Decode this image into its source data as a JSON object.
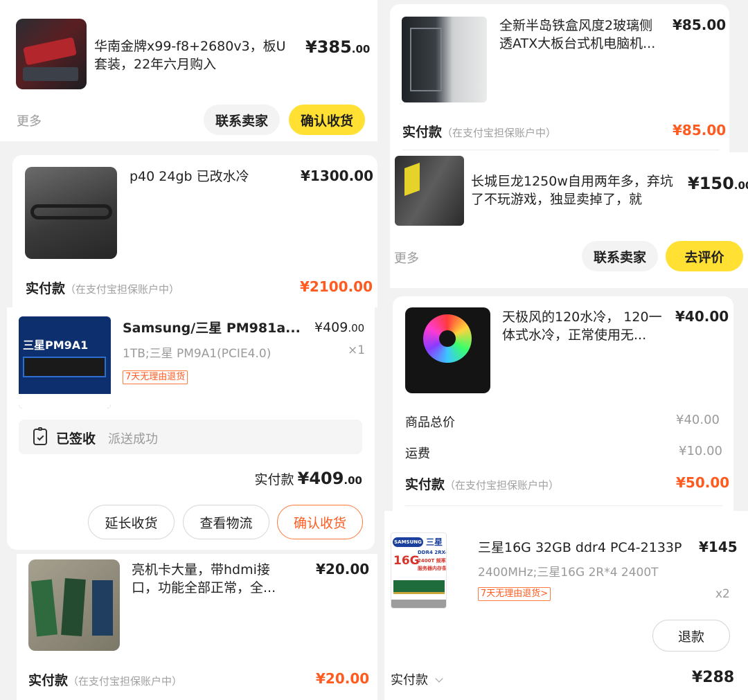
{
  "left": {
    "card1": {
      "title": "华南金牌x99-f8+2680v3，板U套装，22年六月购入",
      "price_int": "¥385",
      "price_dec": ".00",
      "more": "更多",
      "contact": "联系卖家",
      "confirm": "确认收货"
    },
    "card2": {
      "title": "p40 24gb 已改水冷",
      "price": "¥1300.00",
      "pay_label": "实付款",
      "pay_note": "（在支付宝担保账户中）",
      "pay_amount": "¥2100.00"
    },
    "card3": {
      "title": "Samsung/三星 PM981a...",
      "price_int": "¥409",
      "price_dec": ".00",
      "spec": "1TB;三星 PM9A1(PCIE4.0)",
      "qty": "×1",
      "tag": "7天无理由退货",
      "thumb_text": "三星PM9A1",
      "status_bold": "已签收",
      "status_text": "派送成功",
      "paid_label": "实付款",
      "paid_int": "¥409",
      "paid_dec": ".00",
      "btn_extend": "延长收货",
      "btn_logistics": "查看物流",
      "btn_confirm": "确认收货"
    },
    "card4": {
      "title": "亮机卡大量，带hdmi接口，功能全部正常，全...",
      "price": "¥20.00",
      "pay_label": "实付款",
      "pay_note": "（在支付宝担保账户中）",
      "pay_amount": "¥20.00"
    }
  },
  "right": {
    "card1": {
      "title": "全新半岛铁盒风度2玻璃侧透ATX大板台式机电脑机...",
      "price": "¥85.00",
      "pay_label": "实付款",
      "pay_note": "（在支付宝担保账户中）",
      "pay_amount": "¥85.00"
    },
    "card2": {
      "title": "长城巨龙1250w自用两年多，弃坑了不玩游戏，独显卖掉了，就",
      "price_int": "¥150",
      "price_dec": ".00",
      "more": "更多",
      "contact": "联系卖家",
      "review": "去评价"
    },
    "card3": {
      "title": "天极风的120水冷， 120一体式水冷，正常使用无...",
      "price": "¥40.00",
      "subtotal_label": "商品总价",
      "subtotal_value": "¥40.00",
      "shipping_label": "运费",
      "shipping_value": "¥10.00",
      "pay_label": "实付款",
      "pay_note": "（在支付宝担保账户中）",
      "pay_amount": "¥50.00"
    },
    "card4": {
      "title": "三星16G 32GB ddr4 PC4-2133P",
      "price": "¥145",
      "spec": "2400MHz;三星16G 2R*4 2400T",
      "tag": "7天无理由退货>",
      "qty": "x2",
      "thumb_brand": "SAMSUNG",
      "thumb_cn": "三星",
      "thumb_size": "16G",
      "thumb_line1": "DDR4 2RX4",
      "thumb_line2": "2400T 频率",
      "thumb_line3": "服务器内存条",
      "refund": "退款",
      "paid_label": "实付款",
      "paid_amount": "¥288"
    }
  },
  "colors": {
    "accent_yellow": "#ffe033",
    "price_orange": "#ff5a1f",
    "muted_gray": "#9a9a9a"
  }
}
